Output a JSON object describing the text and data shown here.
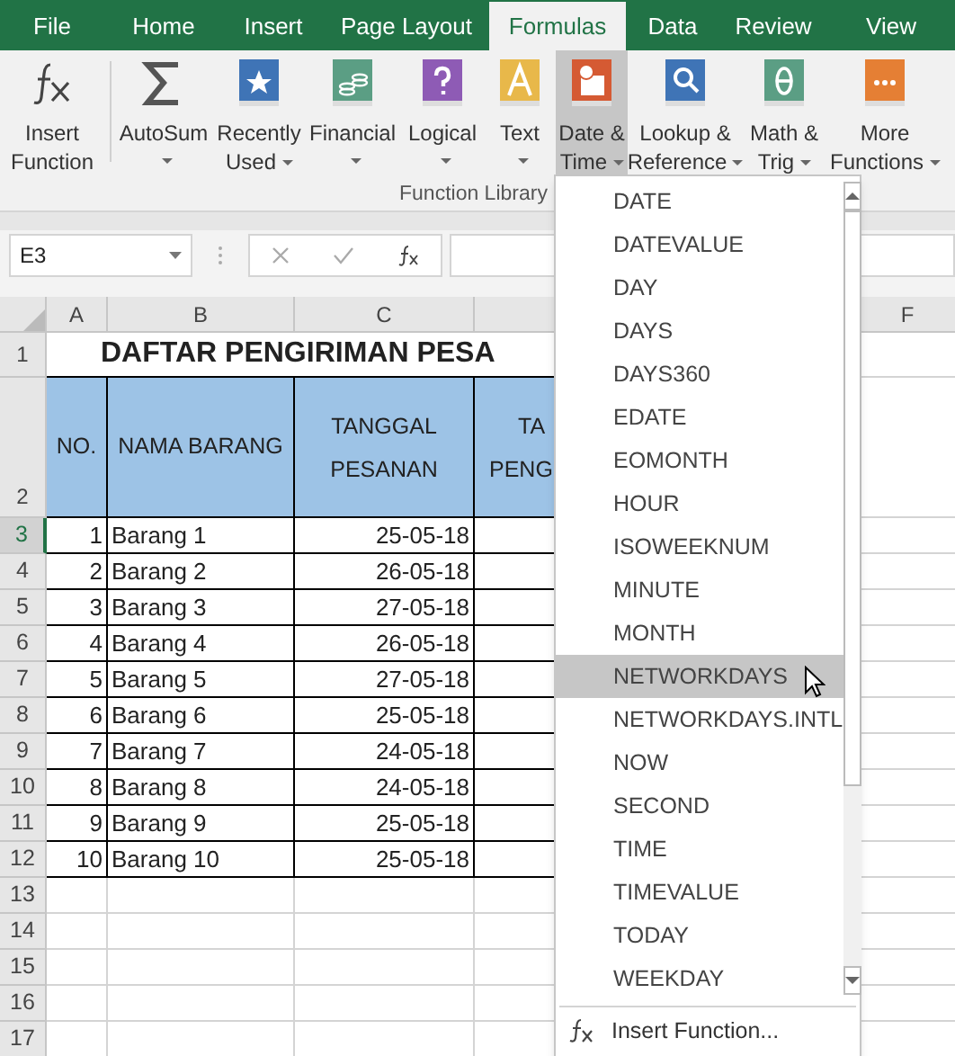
{
  "tabs": [
    {
      "label": "File",
      "selected": false
    },
    {
      "label": "Home",
      "selected": false
    },
    {
      "label": "Insert",
      "selected": false
    },
    {
      "label": "Page Layout",
      "selected": false
    },
    {
      "label": "Formulas",
      "selected": true
    },
    {
      "label": "Data",
      "selected": false
    },
    {
      "label": "Review",
      "selected": false
    },
    {
      "label": "View",
      "selected": false
    }
  ],
  "ribbon": {
    "buttons": [
      {
        "lines": [
          "Insert",
          "Function"
        ],
        "dropdown": false,
        "selected": false
      },
      {
        "lines": [
          "AutoSum"
        ],
        "dropdown": true,
        "selected": false
      },
      {
        "lines": [
          "Recently",
          "Used"
        ],
        "dropdown": true,
        "selected": false
      },
      {
        "lines": [
          "Financial"
        ],
        "dropdown": true,
        "selected": false
      },
      {
        "lines": [
          "Logical"
        ],
        "dropdown": true,
        "selected": false
      },
      {
        "lines": [
          "Text"
        ],
        "dropdown": true,
        "selected": false
      },
      {
        "lines": [
          "Date &",
          "Time"
        ],
        "dropdown": true,
        "selected": true
      },
      {
        "lines": [
          "Lookup &",
          "Reference"
        ],
        "dropdown": true,
        "selected": false
      },
      {
        "lines": [
          "Math &",
          "Trig"
        ],
        "dropdown": true,
        "selected": false
      },
      {
        "lines": [
          "More",
          "Functions"
        ],
        "dropdown": true,
        "selected": false
      }
    ],
    "group_label": "Function Library"
  },
  "formula_bar": {
    "name_box": "E3"
  },
  "sheet": {
    "column_headers": [
      "A",
      "B",
      "C"
    ],
    "column_header_right": "F",
    "title_row": {
      "number": "1",
      "title": "DAFTAR PENGIRIMAN PESA"
    },
    "header_row": {
      "number": "2",
      "no": "NO.",
      "name": "NAMA BARANG",
      "order_date": [
        "TANGGAL",
        "PESANAN"
      ],
      "column_4": [
        "TA",
        "PENG"
      ]
    },
    "rows": [
      {
        "number": "3",
        "selected": true,
        "cells": [
          "1",
          "Barang 1",
          "25-05-18"
        ]
      },
      {
        "number": "4",
        "selected": false,
        "cells": [
          "2",
          "Barang 2",
          "26-05-18"
        ]
      },
      {
        "number": "5",
        "selected": false,
        "cells": [
          "3",
          "Barang 3",
          "27-05-18"
        ]
      },
      {
        "number": "6",
        "selected": false,
        "cells": [
          "4",
          "Barang 4",
          "26-05-18"
        ]
      },
      {
        "number": "7",
        "selected": false,
        "cells": [
          "5",
          "Barang 5",
          "27-05-18"
        ]
      },
      {
        "number": "8",
        "selected": false,
        "cells": [
          "6",
          "Barang 6",
          "25-05-18"
        ]
      },
      {
        "number": "9",
        "selected": false,
        "cells": [
          "7",
          "Barang 7",
          "24-05-18"
        ]
      },
      {
        "number": "10",
        "selected": false,
        "cells": [
          "8",
          "Barang 8",
          "24-05-18"
        ]
      },
      {
        "number": "11",
        "selected": false,
        "cells": [
          "9",
          "Barang 9",
          "25-05-18"
        ]
      },
      {
        "number": "12",
        "selected": false,
        "cells": [
          "10",
          "Barang 10",
          "25-05-18"
        ]
      }
    ],
    "empty_rows": [
      "13",
      "14",
      "15",
      "16",
      "17"
    ]
  },
  "menu": {
    "items": [
      {
        "label": "DATE",
        "selected": false
      },
      {
        "label": "DATEVALUE",
        "selected": false
      },
      {
        "label": "DAY",
        "selected": false
      },
      {
        "label": "DAYS",
        "selected": false
      },
      {
        "label": "DAYS360",
        "selected": false
      },
      {
        "label": "EDATE",
        "selected": false
      },
      {
        "label": "EOMONTH",
        "selected": false
      },
      {
        "label": "HOUR",
        "selected": false
      },
      {
        "label": "ISOWEEKNUM",
        "selected": false
      },
      {
        "label": "MINUTE",
        "selected": false
      },
      {
        "label": "MONTH",
        "selected": false
      },
      {
        "label": "NETWORKDAYS",
        "selected": true
      },
      {
        "label": "NETWORKDAYS.INTL",
        "selected": false
      },
      {
        "label": "NOW",
        "selected": false
      },
      {
        "label": "SECOND",
        "selected": false
      },
      {
        "label": "TIME",
        "selected": false
      },
      {
        "label": "TIMEVALUE",
        "selected": false
      },
      {
        "label": "TODAY",
        "selected": false
      },
      {
        "label": "WEEKDAY",
        "selected": false
      }
    ],
    "footer": "Insert Function..."
  }
}
